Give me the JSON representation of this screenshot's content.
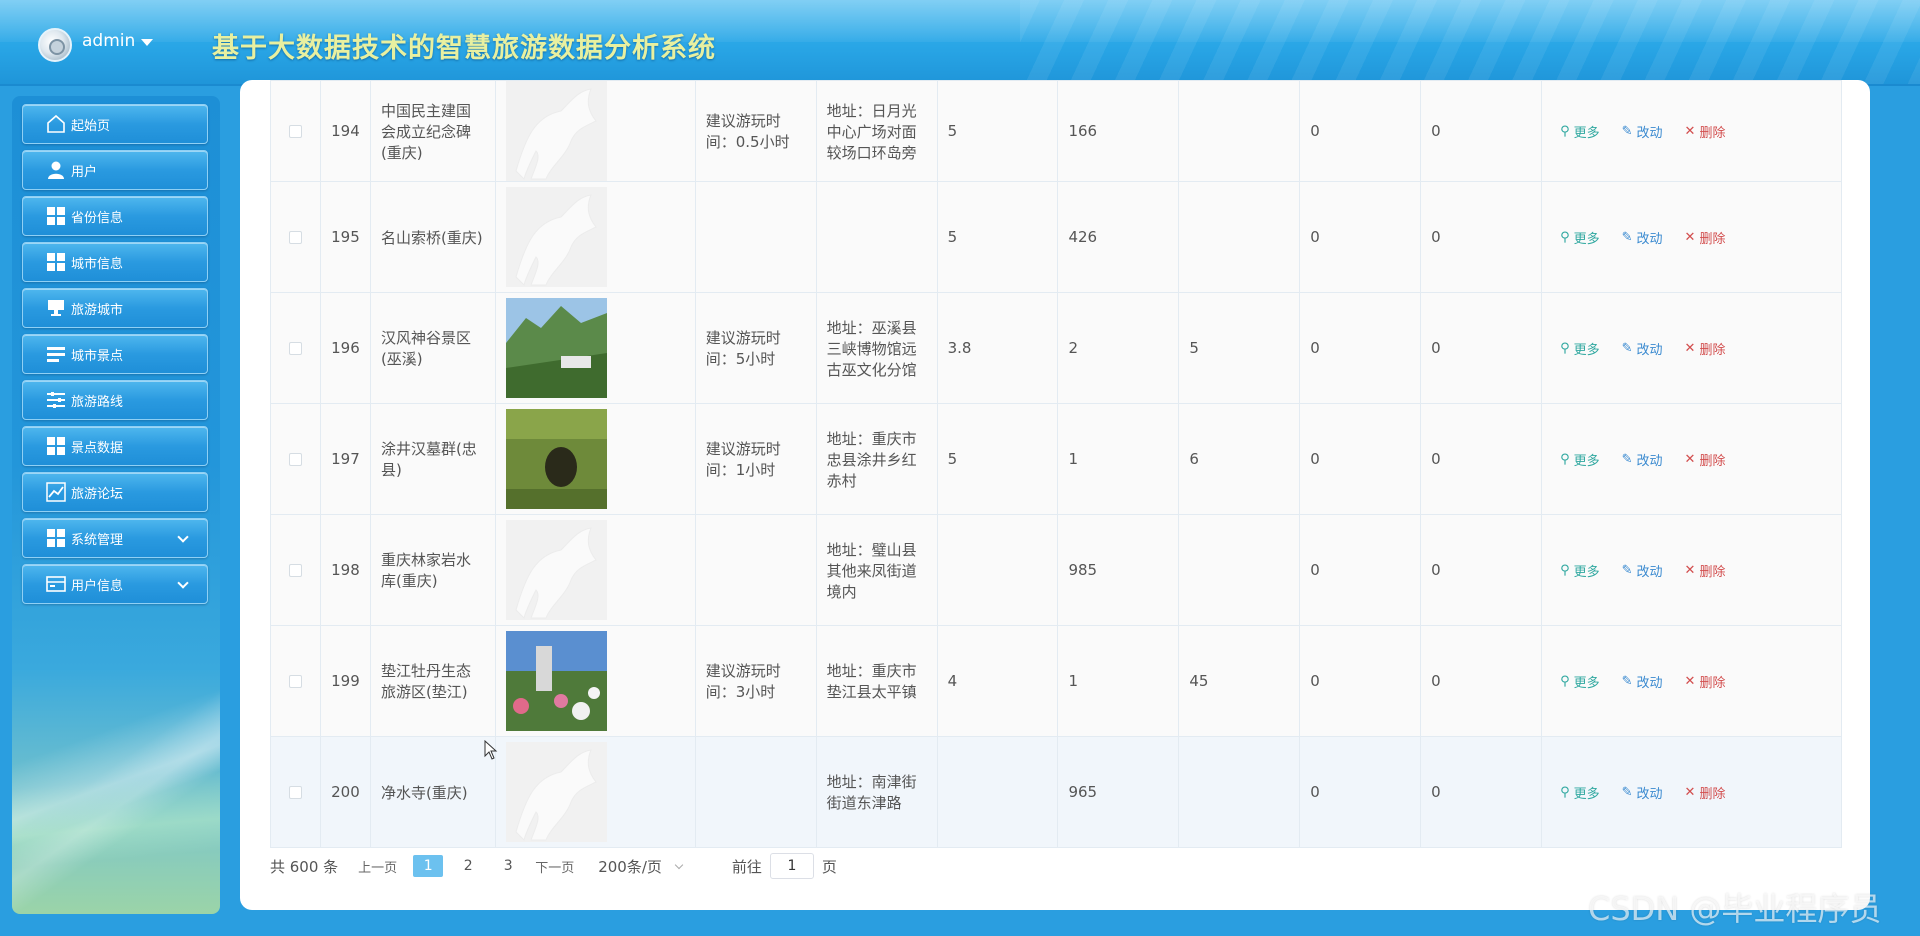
{
  "header": {
    "username": "admin",
    "app_title": "基于大数据技术的智慧旅游数据分析系统"
  },
  "sidebar": {
    "items": [
      {
        "label": "起始页",
        "icon": "home-icon"
      },
      {
        "label": "用户",
        "icon": "user-icon"
      },
      {
        "label": "省份信息",
        "icon": "grid-icon"
      },
      {
        "label": "城市信息",
        "icon": "grid-icon"
      },
      {
        "label": "旅游城市",
        "icon": "monitor-icon"
      },
      {
        "label": "城市景点",
        "icon": "list-icon"
      },
      {
        "label": "旅游路线",
        "icon": "sliders-icon"
      },
      {
        "label": "景点数据",
        "icon": "grid-icon"
      },
      {
        "label": "旅游论坛",
        "icon": "chart-icon"
      },
      {
        "label": "系统管理",
        "icon": "grid-icon"
      },
      {
        "label": "用户信息",
        "icon": "card-icon"
      }
    ]
  },
  "table": {
    "actions": {
      "more": "更多",
      "edit": "改动",
      "delete": "删除"
    },
    "rows": [
      {
        "no": "194",
        "name": "中国民主建国会成立纪念碑(重庆)",
        "time": "建议游玩时间：0.5小时",
        "address": "地址：日月光中心广场对面较场口环岛旁",
        "c1": "5",
        "c2": "166",
        "c3": "",
        "c4": "0",
        "c5": "0"
      },
      {
        "no": "195",
        "name": "名山索桥(重庆)",
        "time": "",
        "address": "",
        "c1": "5",
        "c2": "426",
        "c3": "",
        "c4": "0",
        "c5": "0"
      },
      {
        "no": "196",
        "name": "汉风神谷景区(巫溪)",
        "time": "建议游玩时间：5小时",
        "address": "地址：巫溪县三峡博物馆远古巫文化分馆",
        "c1": "3.8",
        "c2": "2",
        "c3": "5",
        "c4": "0",
        "c5": "0"
      },
      {
        "no": "197",
        "name": "涂井汉墓群(忠县)",
        "time": "建议游玩时间：1小时",
        "address": "地址：重庆市忠县涂井乡红赤村",
        "c1": "5",
        "c2": "1",
        "c3": "6",
        "c4": "0",
        "c5": "0"
      },
      {
        "no": "198",
        "name": "重庆林家岩水库(重庆)",
        "time": "",
        "address": "地址：璧山县其他来凤街道境内",
        "c1": "",
        "c2": "985",
        "c3": "",
        "c4": "0",
        "c5": "0"
      },
      {
        "no": "199",
        "name": "垫江牡丹生态旅游区(垫江)",
        "time": "建议游玩时间：3小时",
        "address": "地址：重庆市垫江县太平镇",
        "c1": "4",
        "c2": "1",
        "c3": "45",
        "c4": "0",
        "c5": "0"
      },
      {
        "no": "200",
        "name": "净水寺(重庆)",
        "time": "",
        "address": "地址：南津街街道东津路",
        "c1": "",
        "c2": "965",
        "c3": "",
        "c4": "0",
        "c5": "0"
      }
    ]
  },
  "pager": {
    "total": "共 600 条",
    "prev": "上一页",
    "pages": [
      "1",
      "2",
      "3"
    ],
    "next": "下一页",
    "size": "200条/页",
    "goto_prefix": "前往",
    "goto_value": "1",
    "goto_suffix": "页"
  },
  "watermark": "CSDN @毕业程序员",
  "colors": {
    "accent": "#2a9ee0",
    "active_page": "#6cc1ef",
    "title": "#e8f0a0"
  }
}
